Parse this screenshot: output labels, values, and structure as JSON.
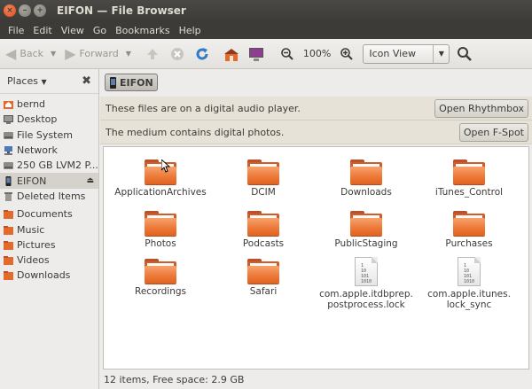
{
  "window": {
    "title": "EIFON — File Browser"
  },
  "menu": [
    "File",
    "Edit",
    "View",
    "Go",
    "Bookmarks",
    "Help"
  ],
  "toolbar": {
    "back_label": "Back",
    "forward_label": "Forward",
    "zoom_level": "100%",
    "view_mode": "Icon View"
  },
  "sidebar": {
    "header": "Places",
    "items": [
      {
        "label": "bernd",
        "icon": "home-folder-icon"
      },
      {
        "label": "Desktop",
        "icon": "desktop-icon"
      },
      {
        "label": "File System",
        "icon": "harddrive-icon"
      },
      {
        "label": "Network",
        "icon": "network-icon"
      },
      {
        "label": "250 GB LVM2 P...",
        "icon": "harddrive-icon"
      },
      {
        "label": "EIFON",
        "icon": "media-player-icon",
        "selected": true
      },
      {
        "label": "Deleted Items",
        "icon": "trash-icon"
      },
      {
        "label": "Documents",
        "icon": "folder-icon"
      },
      {
        "label": "Music",
        "icon": "folder-icon"
      },
      {
        "label": "Pictures",
        "icon": "folder-icon"
      },
      {
        "label": "Videos",
        "icon": "folder-icon"
      },
      {
        "label": "Downloads",
        "icon": "folder-icon"
      }
    ]
  },
  "pathbar": {
    "current": "EIFON"
  },
  "infobars": [
    {
      "message": "These files are on a digital audio player.",
      "button": "Open Rhythmbox"
    },
    {
      "message": "The medium contains digital photos.",
      "button": "Open F-Spot"
    }
  ],
  "files": [
    {
      "name": "ApplicationArchives",
      "type": "folder"
    },
    {
      "name": "DCIM",
      "type": "folder"
    },
    {
      "name": "Downloads",
      "type": "folder"
    },
    {
      "name": "iTunes_Control",
      "type": "folder"
    },
    {
      "name": "Photos",
      "type": "folder"
    },
    {
      "name": "Podcasts",
      "type": "folder"
    },
    {
      "name": "PublicStaging",
      "type": "folder"
    },
    {
      "name": "Purchases",
      "type": "folder"
    },
    {
      "name": "Recordings",
      "type": "folder"
    },
    {
      "name": "Safari",
      "type": "folder"
    },
    {
      "name": "com.apple.itdbprep.\npostprocess.lock",
      "type": "file"
    },
    {
      "name": "com.apple.itunes.\nlock_sync",
      "type": "file"
    }
  ],
  "status": "12 items, Free space: 2.9 GB",
  "colors": {
    "accent": "#df4a16",
    "folder": "#ec7736",
    "titlebar": "#3c3b37"
  }
}
